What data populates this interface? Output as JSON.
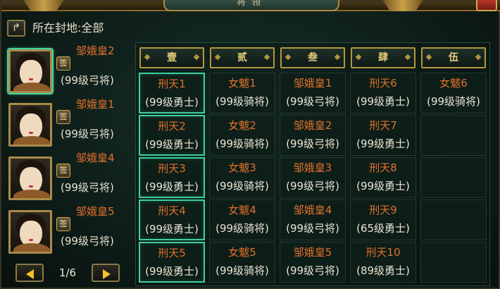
{
  "title": "将领",
  "location_label": "所在封地:全部",
  "generals": [
    {
      "name": "邹娥皇2",
      "badge": "签",
      "level": "(99级弓将)",
      "selected": true
    },
    {
      "name": "邹娥皇1",
      "badge": "签",
      "level": "(99级弓将)",
      "selected": false
    },
    {
      "name": "邹娥皇4",
      "badge": "签",
      "level": "(99级弓将)",
      "selected": false
    },
    {
      "name": "邹娥皇5",
      "badge": "签",
      "level": "(99级弓将)",
      "selected": false
    }
  ],
  "pager": {
    "current": 1,
    "total": 6,
    "text": "1/6"
  },
  "columns": [
    "壹",
    "贰",
    "叁",
    "肆",
    "伍"
  ],
  "rows": [
    [
      {
        "name": "刑天1",
        "level": "(99级勇士)"
      },
      {
        "name": "女魃1",
        "level": "(99级骑将)"
      },
      {
        "name": "邹娥皇1",
        "level": "(99级弓将)"
      },
      {
        "name": "刑天6",
        "level": "(99级勇士)"
      },
      {
        "name": "女魃6",
        "level": "(99级骑将)"
      }
    ],
    [
      {
        "name": "刑天2",
        "level": "(99级勇士)"
      },
      {
        "name": "女魃2",
        "level": "(99级骑将)"
      },
      {
        "name": "邹娥皇2",
        "level": "(99级弓将)"
      },
      {
        "name": "刑天7",
        "level": "(99级勇士)"
      },
      null
    ],
    [
      {
        "name": "刑天3",
        "level": "(99级勇士)"
      },
      {
        "name": "女魃3",
        "level": "(99级骑将)"
      },
      {
        "name": "邹娥皇3",
        "level": "(99级弓将)"
      },
      {
        "name": "刑天8",
        "level": "(99级勇士)"
      },
      null
    ],
    [
      {
        "name": "刑天4",
        "level": "(99级勇士)"
      },
      {
        "name": "女魃4",
        "level": "(99级骑将)"
      },
      {
        "name": "邹娥皇4",
        "level": "(99级弓将)"
      },
      {
        "name": "刑天9",
        "level": "(65级勇士)"
      },
      null
    ],
    [
      {
        "name": "刑天5",
        "level": "(99级勇士)"
      },
      {
        "name": "女魃5",
        "level": "(99级骑将)"
      },
      {
        "name": "邹娥皇5",
        "level": "(99级弓将)"
      },
      {
        "name": "刑天10",
        "level": "(89级勇士)"
      },
      null
    ]
  ],
  "colors": {
    "name_orange": "#e0702c",
    "highlight_teal": "#3fcf9f",
    "gold_border": "#b6953e"
  },
  "icons": {
    "back": "return-arrow-icon",
    "prev": "triangle-left-icon",
    "next": "triangle-right-icon",
    "close": "close-icon"
  }
}
